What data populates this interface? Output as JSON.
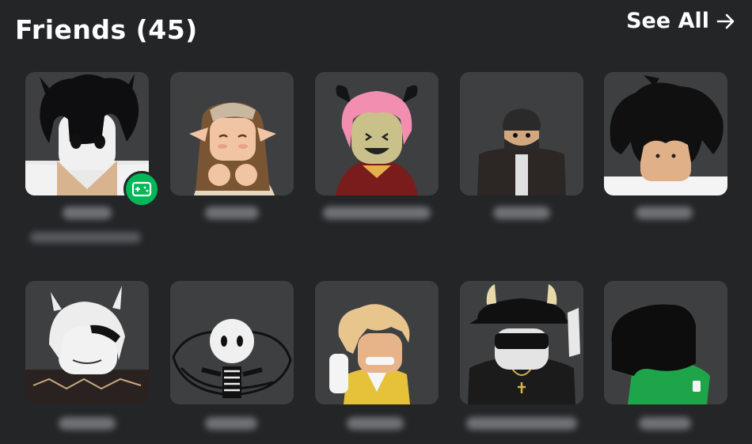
{
  "header": {
    "title": "Friends (45)",
    "see_all_label": "See All",
    "see_all_icon": "arrow-right-icon"
  },
  "friends": [
    {
      "avatar": "avatar-black-hair-cat-ears",
      "presence": "in-game",
      "presence_icon": "gamepad-icon",
      "presence_color": "#02b757"
    },
    {
      "avatar": "avatar-brown-hair-elf"
    },
    {
      "avatar": "avatar-pink-hair-horns"
    },
    {
      "avatar": "avatar-beanie-dark"
    },
    {
      "avatar": "avatar-messy-black-hair"
    },
    {
      "avatar": "avatar-white-hair-wolf-ears"
    },
    {
      "avatar": "avatar-skeleton"
    },
    {
      "avatar": "avatar-blonde-yellow-vest"
    },
    {
      "avatar": "avatar-horned-hat-sunglasses"
    },
    {
      "avatar": "avatar-green-shirt-black-hair"
    }
  ],
  "colors": {
    "background": "#232527",
    "tile": "#393b3d",
    "presence_online": "#02b757"
  }
}
